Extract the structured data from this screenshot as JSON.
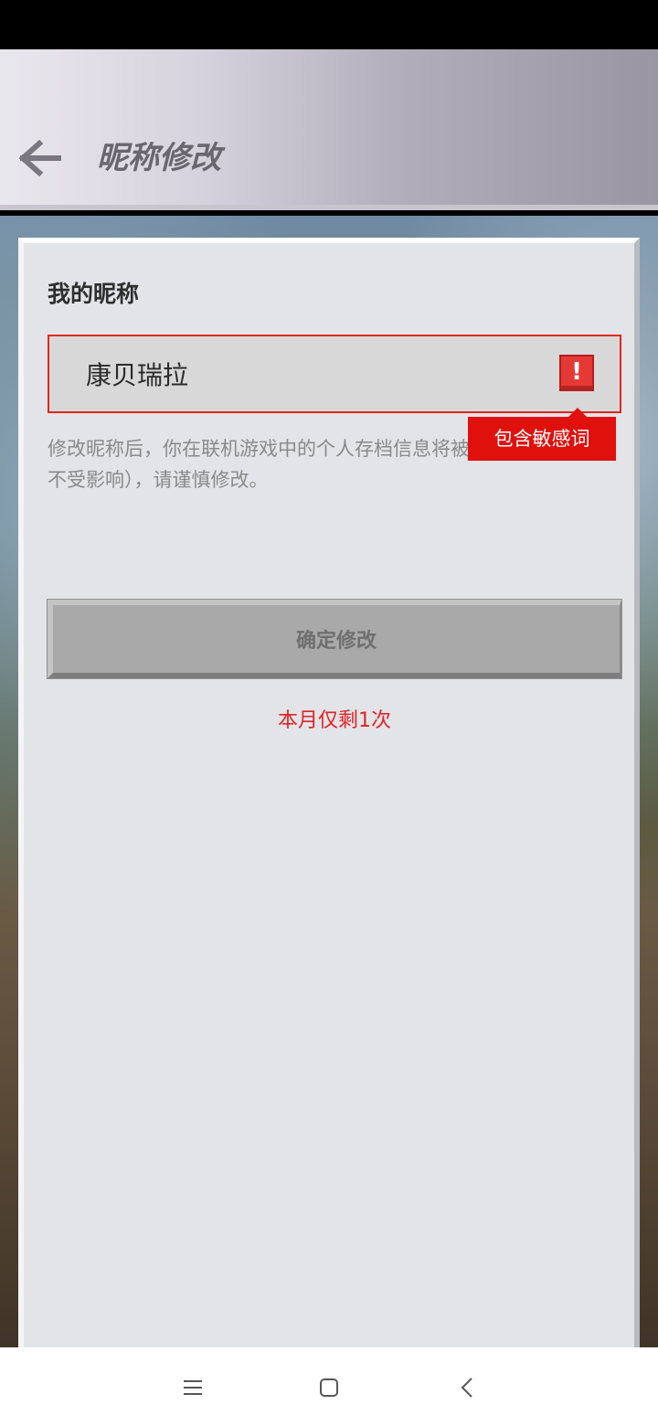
{
  "header": {
    "title": "昵称修改",
    "back_icon": "arrow-left-icon"
  },
  "form": {
    "section_label": "我的昵称",
    "nickname_value": "康贝瑞拉",
    "error_badge": "!",
    "error_tooltip": "包含敏感词",
    "notice": "修改昵称后，你在联机游戏中的个人存档信息将被重置（单机存档不受影响），请谨慎修改。",
    "confirm_label": "确定修改",
    "remaining_text": "本月仅剩1次"
  },
  "nav": {
    "menu_icon": "menu-icon",
    "home_icon": "home-icon",
    "back_icon": "chevron-left-icon"
  },
  "colors": {
    "error": "#e0100c",
    "panel": "#e3e4e8",
    "button_disabled": "#a9a9a9"
  }
}
